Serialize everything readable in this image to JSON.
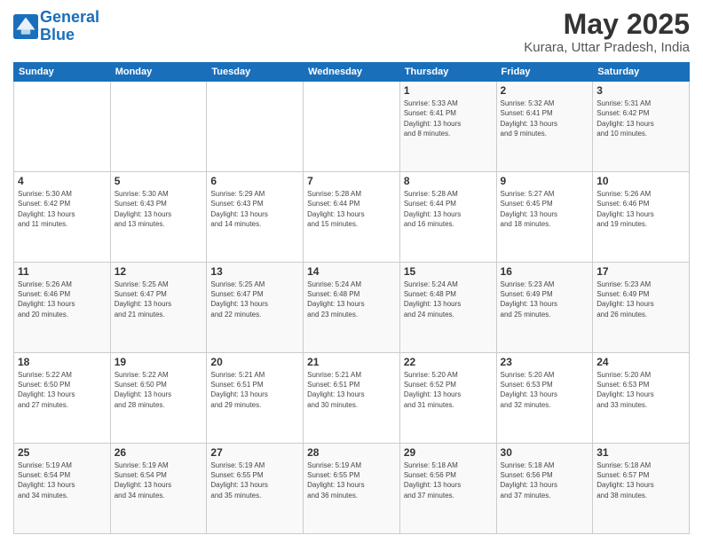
{
  "header": {
    "logo_line1": "General",
    "logo_line2": "Blue",
    "month_year": "May 2025",
    "location": "Kurara, Uttar Pradesh, India"
  },
  "weekdays": [
    "Sunday",
    "Monday",
    "Tuesday",
    "Wednesday",
    "Thursday",
    "Friday",
    "Saturday"
  ],
  "weeks": [
    [
      {
        "day": "",
        "info": ""
      },
      {
        "day": "",
        "info": ""
      },
      {
        "day": "",
        "info": ""
      },
      {
        "day": "",
        "info": ""
      },
      {
        "day": "1",
        "info": "Sunrise: 5:33 AM\nSunset: 6:41 PM\nDaylight: 13 hours\nand 8 minutes."
      },
      {
        "day": "2",
        "info": "Sunrise: 5:32 AM\nSunset: 6:41 PM\nDaylight: 13 hours\nand 9 minutes."
      },
      {
        "day": "3",
        "info": "Sunrise: 5:31 AM\nSunset: 6:42 PM\nDaylight: 13 hours\nand 10 minutes."
      }
    ],
    [
      {
        "day": "4",
        "info": "Sunrise: 5:30 AM\nSunset: 6:42 PM\nDaylight: 13 hours\nand 11 minutes."
      },
      {
        "day": "5",
        "info": "Sunrise: 5:30 AM\nSunset: 6:43 PM\nDaylight: 13 hours\nand 13 minutes."
      },
      {
        "day": "6",
        "info": "Sunrise: 5:29 AM\nSunset: 6:43 PM\nDaylight: 13 hours\nand 14 minutes."
      },
      {
        "day": "7",
        "info": "Sunrise: 5:28 AM\nSunset: 6:44 PM\nDaylight: 13 hours\nand 15 minutes."
      },
      {
        "day": "8",
        "info": "Sunrise: 5:28 AM\nSunset: 6:44 PM\nDaylight: 13 hours\nand 16 minutes."
      },
      {
        "day": "9",
        "info": "Sunrise: 5:27 AM\nSunset: 6:45 PM\nDaylight: 13 hours\nand 18 minutes."
      },
      {
        "day": "10",
        "info": "Sunrise: 5:26 AM\nSunset: 6:46 PM\nDaylight: 13 hours\nand 19 minutes."
      }
    ],
    [
      {
        "day": "11",
        "info": "Sunrise: 5:26 AM\nSunset: 6:46 PM\nDaylight: 13 hours\nand 20 minutes."
      },
      {
        "day": "12",
        "info": "Sunrise: 5:25 AM\nSunset: 6:47 PM\nDaylight: 13 hours\nand 21 minutes."
      },
      {
        "day": "13",
        "info": "Sunrise: 5:25 AM\nSunset: 6:47 PM\nDaylight: 13 hours\nand 22 minutes."
      },
      {
        "day": "14",
        "info": "Sunrise: 5:24 AM\nSunset: 6:48 PM\nDaylight: 13 hours\nand 23 minutes."
      },
      {
        "day": "15",
        "info": "Sunrise: 5:24 AM\nSunset: 6:48 PM\nDaylight: 13 hours\nand 24 minutes."
      },
      {
        "day": "16",
        "info": "Sunrise: 5:23 AM\nSunset: 6:49 PM\nDaylight: 13 hours\nand 25 minutes."
      },
      {
        "day": "17",
        "info": "Sunrise: 5:23 AM\nSunset: 6:49 PM\nDaylight: 13 hours\nand 26 minutes."
      }
    ],
    [
      {
        "day": "18",
        "info": "Sunrise: 5:22 AM\nSunset: 6:50 PM\nDaylight: 13 hours\nand 27 minutes."
      },
      {
        "day": "19",
        "info": "Sunrise: 5:22 AM\nSunset: 6:50 PM\nDaylight: 13 hours\nand 28 minutes."
      },
      {
        "day": "20",
        "info": "Sunrise: 5:21 AM\nSunset: 6:51 PM\nDaylight: 13 hours\nand 29 minutes."
      },
      {
        "day": "21",
        "info": "Sunrise: 5:21 AM\nSunset: 6:51 PM\nDaylight: 13 hours\nand 30 minutes."
      },
      {
        "day": "22",
        "info": "Sunrise: 5:20 AM\nSunset: 6:52 PM\nDaylight: 13 hours\nand 31 minutes."
      },
      {
        "day": "23",
        "info": "Sunrise: 5:20 AM\nSunset: 6:53 PM\nDaylight: 13 hours\nand 32 minutes."
      },
      {
        "day": "24",
        "info": "Sunrise: 5:20 AM\nSunset: 6:53 PM\nDaylight: 13 hours\nand 33 minutes."
      }
    ],
    [
      {
        "day": "25",
        "info": "Sunrise: 5:19 AM\nSunset: 6:54 PM\nDaylight: 13 hours\nand 34 minutes."
      },
      {
        "day": "26",
        "info": "Sunrise: 5:19 AM\nSunset: 6:54 PM\nDaylight: 13 hours\nand 34 minutes."
      },
      {
        "day": "27",
        "info": "Sunrise: 5:19 AM\nSunset: 6:55 PM\nDaylight: 13 hours\nand 35 minutes."
      },
      {
        "day": "28",
        "info": "Sunrise: 5:19 AM\nSunset: 6:55 PM\nDaylight: 13 hours\nand 36 minutes."
      },
      {
        "day": "29",
        "info": "Sunrise: 5:18 AM\nSunset: 6:56 PM\nDaylight: 13 hours\nand 37 minutes."
      },
      {
        "day": "30",
        "info": "Sunrise: 5:18 AM\nSunset: 6:56 PM\nDaylight: 13 hours\nand 37 minutes."
      },
      {
        "day": "31",
        "info": "Sunrise: 5:18 AM\nSunset: 6:57 PM\nDaylight: 13 hours\nand 38 minutes."
      }
    ]
  ]
}
